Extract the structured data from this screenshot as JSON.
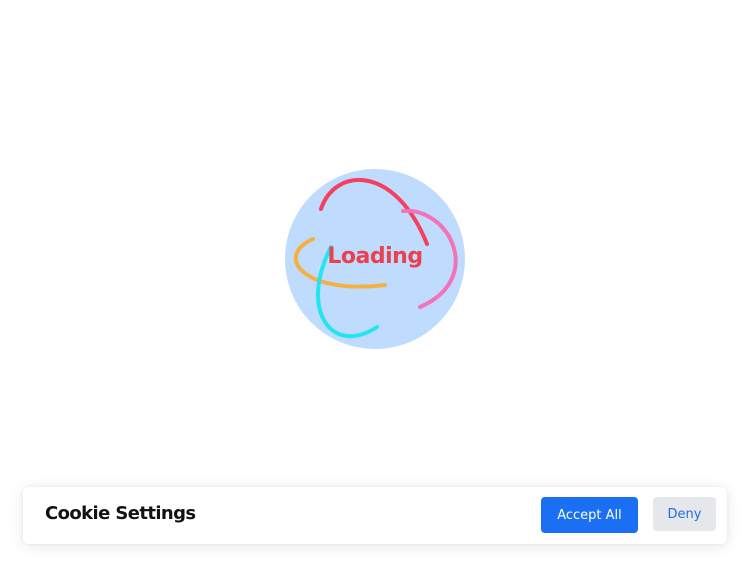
{
  "loader": {
    "text": "Loading",
    "circle_color": "#bfdbfe",
    "text_color": "#e9414e",
    "ring_colors": [
      "#f43f5e",
      "#f472b6",
      "#f5b041",
      "#22e5f0"
    ]
  },
  "cookie_banner": {
    "title": "Cookie Settings",
    "accept_label": "Accept All",
    "deny_label": "Deny",
    "accept_color": "#1a6ff2",
    "deny_bg_color": "#e6e7ea"
  }
}
